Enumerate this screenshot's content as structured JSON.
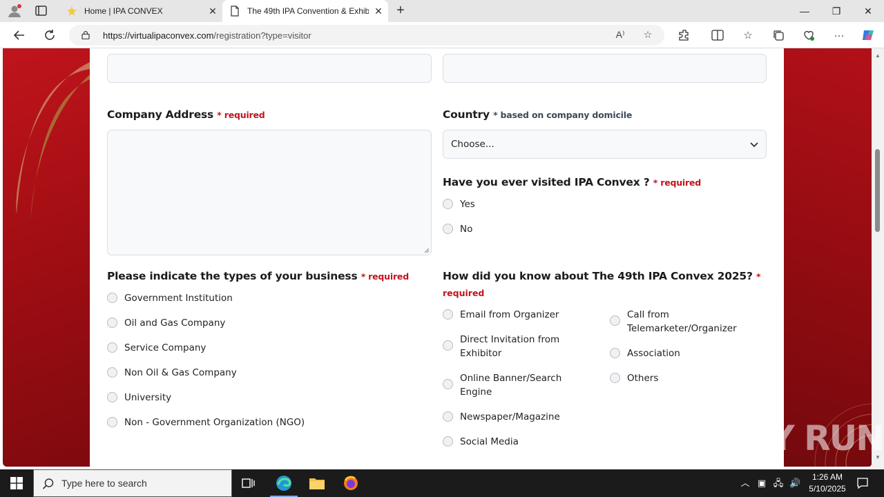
{
  "browser": {
    "tabs": [
      {
        "title": "Home | IPA CONVEX",
        "active": false
      },
      {
        "title": "The 49th IPA Convention & Exhib",
        "active": true
      }
    ],
    "url_host": "https://virtualipaconvex.com",
    "url_path": "/registration?type=visitor",
    "window_controls": {
      "minimize": "—",
      "restore": "❐",
      "close": "✕"
    }
  },
  "form": {
    "company_address": {
      "label": "Company Address",
      "required": "* required"
    },
    "country": {
      "label": "Country",
      "note": "* based on company domicile",
      "selected": "Choose..."
    },
    "visited": {
      "label": "Have you ever visited IPA Convex ?",
      "required": "* required",
      "options": [
        "Yes",
        "No"
      ]
    },
    "business_types": {
      "label": "Please indicate the types of your business",
      "required": "* required",
      "options": [
        "Government Institution",
        "Oil and Gas Company",
        "Service Company",
        "Non Oil & Gas Company",
        "University",
        "Non - Government Organization (NGO)"
      ]
    },
    "source": {
      "label": "How did you know about The 49th IPA Convex 2025?",
      "required_star": "*",
      "required": "required",
      "options_col1": [
        {
          "line1": "Email from Organizer",
          "line2": ""
        },
        {
          "line1": "Direct Invitation from",
          "line2": "Exhibitor"
        },
        {
          "line1": "Online Banner/Search",
          "line2": "Engine"
        },
        {
          "line1": "Newspaper/Magazine",
          "line2": ""
        },
        {
          "line1": "Social Media",
          "line2": ""
        }
      ],
      "options_col2": [
        {
          "line1": "Call from",
          "line2": "Telemarketer/Organizer"
        },
        {
          "line1": "Association",
          "line2": ""
        },
        {
          "line1": "Others",
          "line2": ""
        }
      ]
    }
  },
  "watermark": "ANY RUN",
  "taskbar": {
    "search_placeholder": "Type here to search",
    "time": "1:26 AM",
    "date": "5/10/2025"
  },
  "colors": {
    "brand_red": "#c0141c",
    "required": "#c0141c"
  }
}
